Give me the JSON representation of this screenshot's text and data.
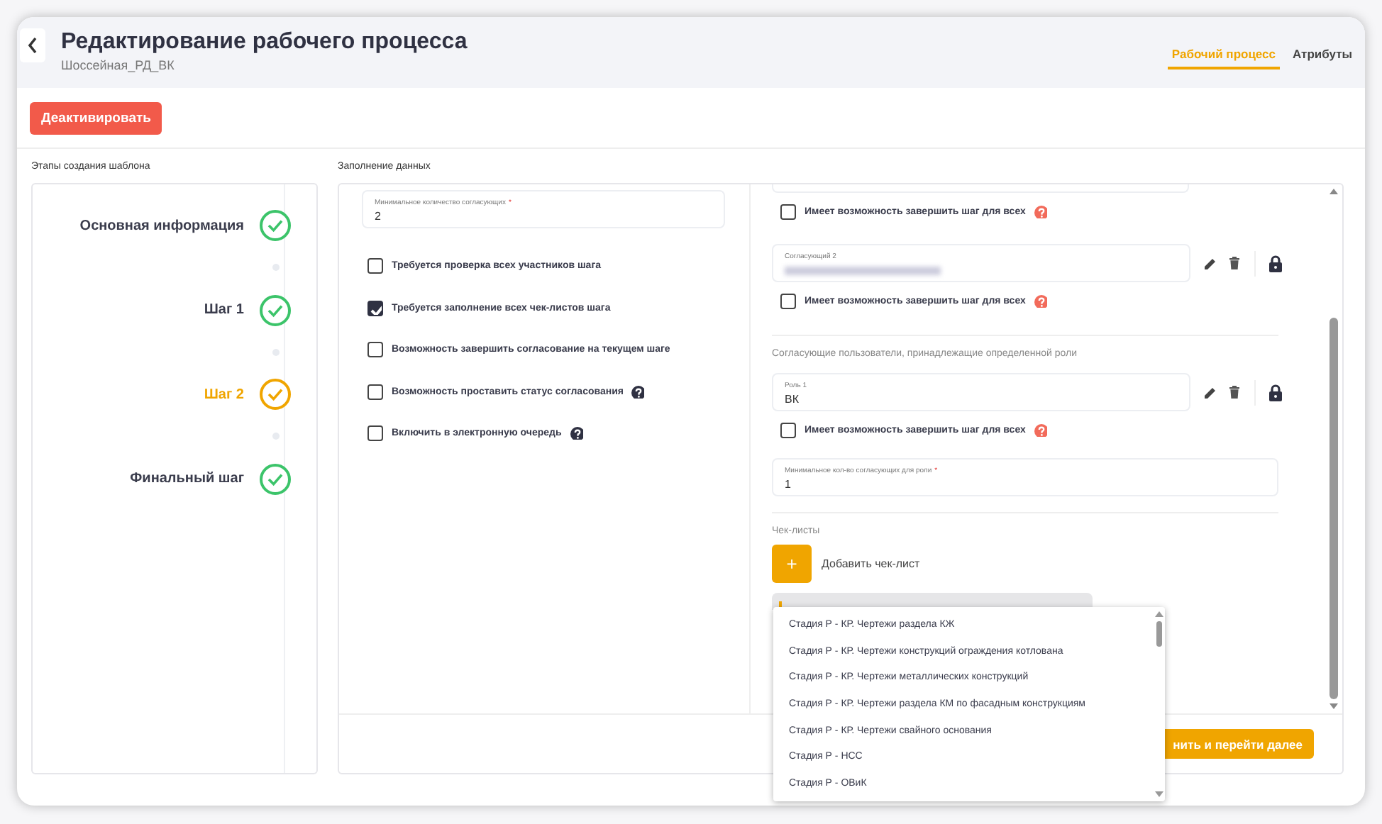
{
  "header": {
    "title": "Редактирование рабочего процесса",
    "subtitle": "Шоссейная_РД_ВК",
    "tabs": [
      {
        "label": "Рабочий процесс",
        "selected": true
      },
      {
        "label": "Атрибуты",
        "selected": false
      }
    ]
  },
  "deactivate_button": "Деактивировать",
  "steps_panel": {
    "title": "Этапы создания шаблона",
    "steps": [
      {
        "label": "Основная информация",
        "current": false
      },
      {
        "label": "Шаг 1",
        "current": false
      },
      {
        "label": "Шаг 2",
        "current": true
      },
      {
        "label": "Финальный шаг",
        "current": false
      }
    ]
  },
  "data_panel": {
    "title": "Заполнение данных",
    "min_approvers": {
      "label": "Минимальное количество согласующих",
      "required_mark": "*",
      "value": "2"
    },
    "options": [
      {
        "label": "Требуется проверка всех участников шага",
        "checked": false,
        "help": false
      },
      {
        "label": "Требуется заполнение всех чек-листов шага",
        "checked": true,
        "help": false
      },
      {
        "label": "Возможность завершить согласование на текущем шаге",
        "checked": false,
        "help": false
      },
      {
        "label": "Возможность проставить статус согласования",
        "checked": false,
        "help": true
      },
      {
        "label": "Включить в электронную очередь",
        "checked": false,
        "help": true
      }
    ],
    "right_items": [
      {
        "kind": "cut_field"
      },
      {
        "kind": "checkbox",
        "label": "Имеет возможность завершить шаг для всех",
        "checked": false,
        "help": true
      },
      {
        "kind": "approver",
        "label": "Согласующий 2",
        "value_hidden": true
      },
      {
        "kind": "checkbox",
        "label": "Имеет возможность завершить шаг для всех",
        "checked": false,
        "help": true
      },
      {
        "kind": "divider"
      },
      {
        "kind": "section",
        "label": "Согласующие пользователи, принадлежащие определенной роли"
      },
      {
        "kind": "approver",
        "label": "Роль 1",
        "value": "ВК"
      },
      {
        "kind": "checkbox",
        "label": "Имеет возможность завершить шаг для всех",
        "checked": false,
        "help": true
      },
      {
        "kind": "field",
        "label": "Минимальное кол-во согласующих для роли",
        "required_mark": "*",
        "value": "1"
      },
      {
        "kind": "divider"
      },
      {
        "kind": "section",
        "label": "Чек-листы"
      },
      {
        "kind": "add",
        "icon": "+",
        "label": "Добавить чек-лист"
      },
      {
        "kind": "select"
      }
    ],
    "dropdown": [
      "Стадия Р - КР. Чертежи раздела КЖ",
      "Стадия Р - КР. Чертежи конструкций ограждения котлована",
      "Стадия Р - КР. Чертежи металлических конструкций",
      "Стадия Р - КР. Чертежи раздела КМ по фасадным конструкциям",
      "Стадия Р - КР. Чертежи свайного основания",
      "Стадия Р - НСС",
      "Стадия Р - ОВиК"
    ],
    "save_button": "нить и перейти далее"
  }
}
